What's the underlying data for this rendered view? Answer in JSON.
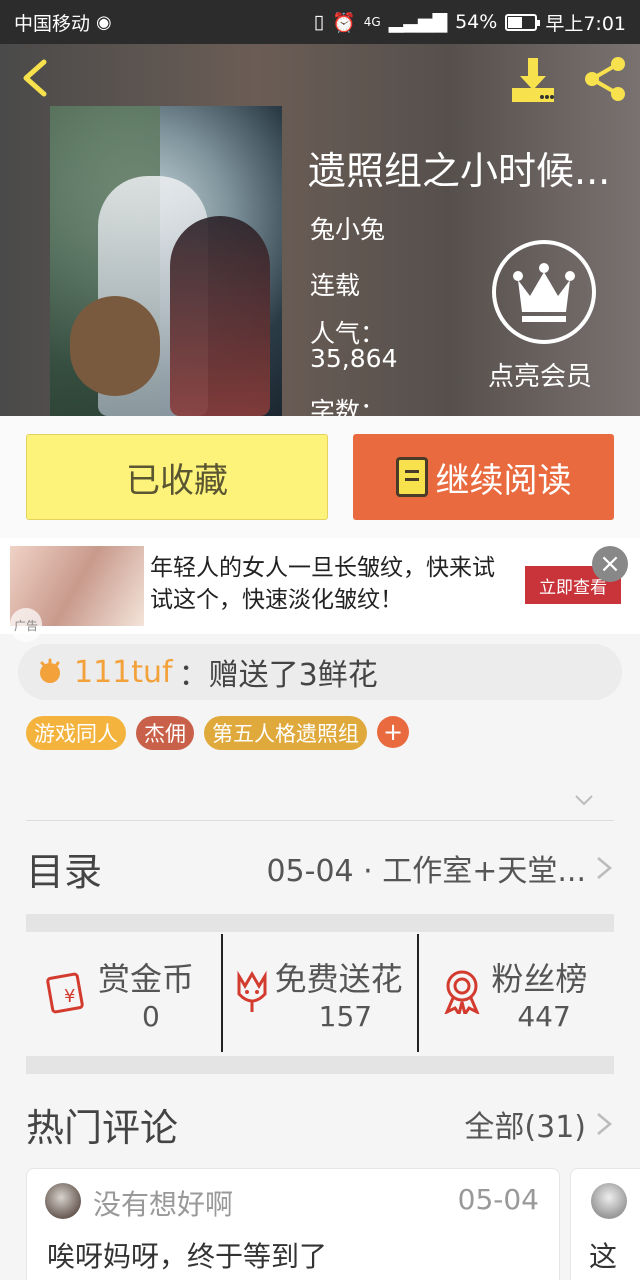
{
  "status_bar": {
    "carrier": "中国移动",
    "network": "4G",
    "battery": "54%",
    "time": "早上7:01"
  },
  "header": {
    "title": "遗照组之小时候...",
    "author": "兔小兔",
    "status": "连载",
    "popularity_label": "人气：",
    "popularity_value": "35,864",
    "words_label": "字数：",
    "member_label": "点亮会员"
  },
  "actions": {
    "favorited": "已收藏",
    "continue_reading": "继续阅读"
  },
  "ad": {
    "text": "年轻人的女人一旦长皱纹，快来试试这个，快速淡化皱纹！",
    "cta": "立即查看",
    "badge": "广告"
  },
  "notice": {
    "user": "111tuf",
    "message": "：赠送了3鲜花"
  },
  "tags": [
    {
      "label": "游戏同人",
      "color": "#f3b33d"
    },
    {
      "label": "杰佣",
      "color": "#c9604a"
    },
    {
      "label": "第五人格遗照组",
      "color": "#e0a93c"
    }
  ],
  "toc": {
    "label": "目录",
    "latest": "05-04 · 工作室+天堂..."
  },
  "stats": [
    {
      "label": "赏金币",
      "value": "0",
      "icon": "gold-coin-icon"
    },
    {
      "label": "免费送花",
      "value": "157",
      "icon": "flower-icon"
    },
    {
      "label": "粉丝榜",
      "value": "447",
      "icon": "medal-icon"
    }
  ],
  "comments": {
    "title": "热门评论",
    "all": "全部(31)",
    "items": [
      {
        "user": "没有想好啊",
        "date": "05-04",
        "text": "唉呀妈呀，终于等到了"
      },
      {
        "user": "",
        "date": "",
        "text": "这"
      }
    ]
  },
  "colors": {
    "accent_orange": "#ea6a3f",
    "fav_yellow": "#fdf27a",
    "icon_yellow": "#f7e24e",
    "stat_red": "#d33b2f"
  }
}
